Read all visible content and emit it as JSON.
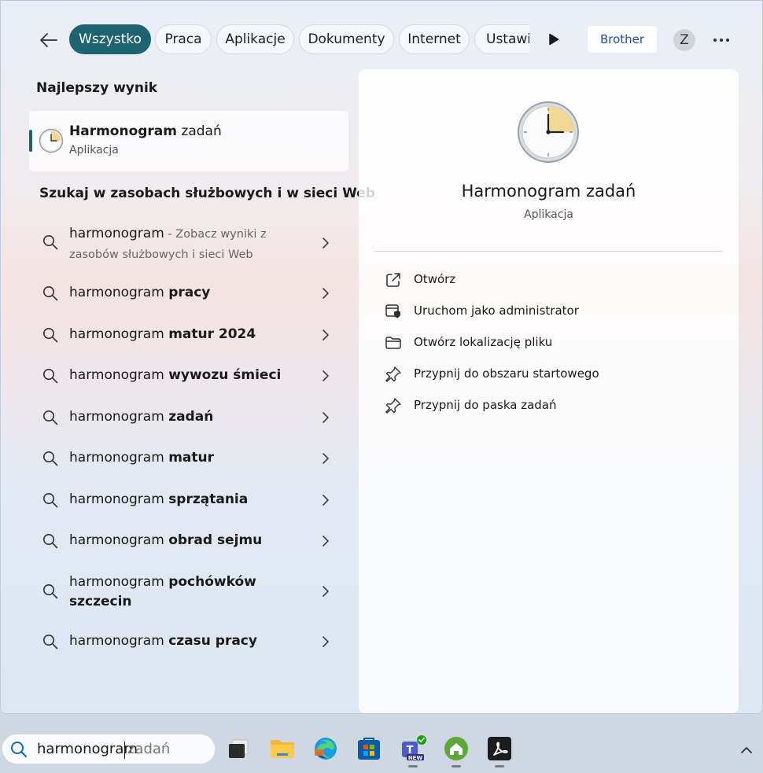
{
  "filters": {
    "tabs": [
      {
        "label": "Wszystko"
      },
      {
        "label": "Praca"
      },
      {
        "label": "Aplikacje"
      },
      {
        "label": "Dokumenty"
      },
      {
        "label": "Internet"
      },
      {
        "label": "Ustawi"
      }
    ],
    "brother_label": "Brother",
    "avatar_letter": "Z"
  },
  "best_match": {
    "title": "Najlepszy wynik",
    "name_bold": "Harmonogram",
    "name_rest": " zadań",
    "type": "Aplikacja",
    "icon": "clock-icon"
  },
  "web_section": {
    "title": "Szukaj w zasobach służbowych i w sieci Web",
    "items": [
      {
        "prefix": "harmonogram",
        "hint": " - Zobacz wyniki z",
        "line2": "zasobów służbowych i sieci Web"
      },
      {
        "prefix": "harmonogram ",
        "bold": "pracy"
      },
      {
        "prefix": "harmonogram ",
        "bold": "matur 2024"
      },
      {
        "prefix": "harmonogram ",
        "bold": "wywozu śmieci"
      },
      {
        "prefix": "harmonogram ",
        "bold": "zadań"
      },
      {
        "prefix": "harmonogram ",
        "bold": "matur"
      },
      {
        "prefix": "harmonogram ",
        "bold": "sprzątania"
      },
      {
        "prefix": "harmonogram ",
        "bold": "obrad sejmu"
      },
      {
        "prefix": "harmonogram ",
        "bold": "pochówków",
        "line2": "szczecin"
      },
      {
        "prefix": "harmonogram ",
        "bold": "czasu pracy"
      }
    ]
  },
  "detail": {
    "name": "Harmonogram zadań",
    "type": "Aplikacja",
    "actions": [
      {
        "label": "Otwórz",
        "icon": "open-external-icon"
      },
      {
        "label": "Uruchom jako administrator",
        "icon": "shield-admin-icon"
      },
      {
        "label": "Otwórz lokalizację pliku",
        "icon": "folder-icon"
      },
      {
        "label": "Przypnij do obszaru startowego",
        "icon": "pin-icon"
      },
      {
        "label": "Przypnij do paska zadań",
        "icon": "pin-icon"
      }
    ]
  },
  "taskbar": {
    "search_typed": "harmonogram",
    "search_suggestion": "zadań",
    "apps": [
      {
        "name": "task-view-icon"
      },
      {
        "name": "file-explorer-icon"
      },
      {
        "name": "edge-icon"
      },
      {
        "name": "store-icon"
      },
      {
        "name": "teams-icon",
        "badge": "NEW"
      },
      {
        "name": "home-icon"
      },
      {
        "name": "pdf-reader-icon"
      }
    ]
  },
  "colors": {
    "accent": "#1e6470",
    "brother_text": "#1d4fa0"
  }
}
